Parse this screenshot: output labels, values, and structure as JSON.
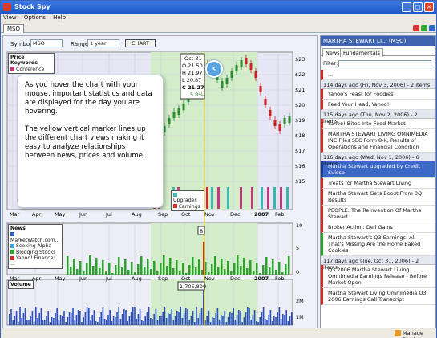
{
  "window": {
    "title": "Stock Spy",
    "menu": [
      "View",
      "Options",
      "Help"
    ],
    "tab": "MSO"
  },
  "toolbar": {
    "symbol_label": "Symbol:",
    "symbol_value": "MSO",
    "range_label": "Range:",
    "range_value": "1 year",
    "chart_button": "CHART"
  },
  "price_legend": {
    "title": "Price Keywords",
    "items": [
      {
        "label": "Conference",
        "color": "#c0397a"
      }
    ]
  },
  "price_legend2": [
    {
      "label": "Upgrades",
      "color": "#39b7b0"
    },
    {
      "label": "Earnings",
      "color": "#d42a2a"
    }
  ],
  "ohlc": {
    "date": "Oct 31",
    "o": "O 21.50",
    "h": "H 21.97",
    "l": "L 20.87",
    "c": "C 21.27",
    "change": "5.8%"
  },
  "tooltip": {
    "p1": "As you hover the chart with your mouse, important statistics and data are displayed for the day you are hovering.",
    "p2": "The yellow vertical marker lines up the different chart views making it easy to analyze relationships between news, prices and volume."
  },
  "months": [
    "Mar",
    "Apr",
    "May",
    "Jun",
    "Jul",
    "Aug",
    "Sep",
    "Oct",
    "Nov",
    "Dec",
    "2007",
    "Feb"
  ],
  "price_ticks": [
    "$23",
    "$22",
    "$21",
    "$20",
    "$19",
    "$18",
    "$17",
    "$16",
    "$15"
  ],
  "news": {
    "title": "News",
    "items": [
      {
        "label": "MarketWatch.com...",
        "color": "#2a5fc6"
      },
      {
        "label": "Seeking Alpha",
        "color": "#39a7d6"
      },
      {
        "label": "Blogging Stocks",
        "color": "#28a428"
      },
      {
        "label": "Yahoo! Finance: ...",
        "color": "#d42a2a"
      }
    ],
    "count_label": "8",
    "ticks": [
      "10",
      "5",
      "0"
    ]
  },
  "volume": {
    "title": "Volume",
    "value_label": "1,705,800",
    "ticks": [
      "2M",
      "1M"
    ]
  },
  "sidebar": {
    "header": "MARTHA STEWART LI... (MSO)",
    "tabs": [
      "News",
      "Fundamentals"
    ],
    "filter_label": "Filter:",
    "feed": [
      {
        "type": "item",
        "text": "...",
        "color": "r"
      },
      {
        "type": "day",
        "text": "114 days ago (Fri, Nov 3, 2006) - 2 items"
      },
      {
        "type": "item",
        "text": "Yahoo's Feast for Foodies",
        "color": "r"
      },
      {
        "type": "item",
        "text": "Feed Your Head, Yahoo!",
        "color": "r"
      },
      {
        "type": "day",
        "text": "115 days ago (Thu, Nov 2, 2006) - 2 items"
      },
      {
        "type": "item",
        "text": "Yahoo! Bites Into Food Market",
        "color": "r"
      },
      {
        "type": "item",
        "text": "MARTHA STEWART LIVING OMNIMEDIA INC Files SEC Form 8-K, Results of Operations and Financial Condition",
        "color": "r"
      },
      {
        "type": "day",
        "text": "116 days ago (Wed, Nov 1, 2006) - 6 items"
      },
      {
        "type": "item",
        "text": "Martha Stewart upgraded by Credit Suisse",
        "color": "sel"
      },
      {
        "type": "item",
        "text": "Treats for Martha Stewart Living",
        "color": "r"
      },
      {
        "type": "item",
        "text": "Martha Stewart Gets Boost From 3Q Results",
        "color": "r"
      },
      {
        "type": "item",
        "text": "PEOPLE: The Reinvention Of Martha Stewart",
        "color": "r"
      },
      {
        "type": "item",
        "text": "Broker Action: Dell Gains",
        "color": "r"
      },
      {
        "type": "item",
        "text": "Martha Stewart's Q3 Earnings: All That's Missing Are the Home Baked Cookies",
        "color": "g"
      },
      {
        "type": "day",
        "text": "117 days ago (Tue, Oct 31, 2006) - 2 items"
      },
      {
        "type": "item",
        "text": "Q3 2006 Martha Stewart Living Omnimedia Earnings Release - Before Market Open",
        "color": "r"
      },
      {
        "type": "item",
        "text": "Martha Stewart Living Omnimedia Q3 2006 Earnings Call Transcript",
        "color": "r"
      }
    ]
  },
  "status": {
    "manage_feeds": "Manage Feeds"
  }
}
